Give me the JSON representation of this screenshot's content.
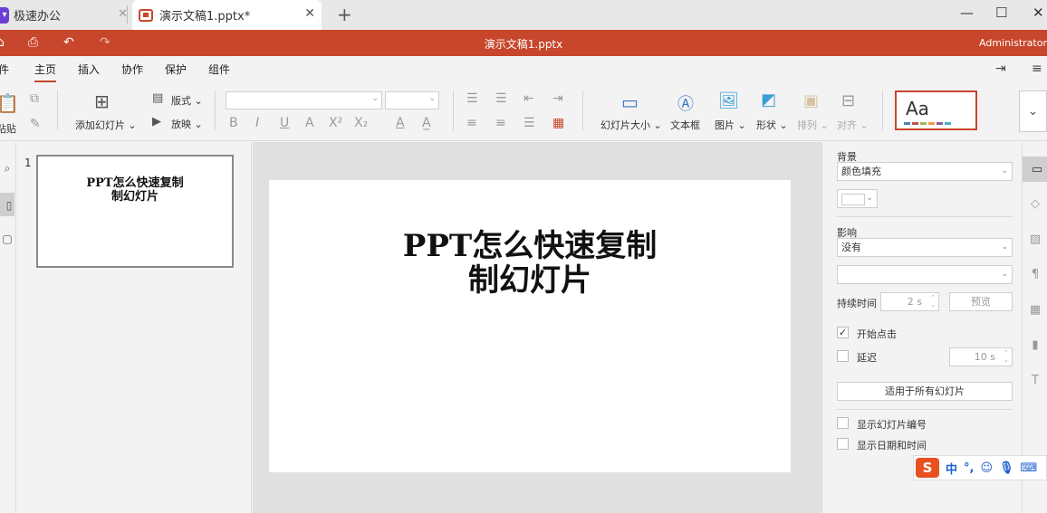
{
  "tabs": [
    {
      "label": "极速办公"
    },
    {
      "label": "演示文稿1.pptx*"
    }
  ],
  "title_bar": {
    "title": "演示文稿1.pptx",
    "user": "Administrator"
  },
  "menu": [
    "件",
    "主页",
    "插入",
    "协作",
    "保护",
    "组件"
  ],
  "ribbon": {
    "paste": "粘贴",
    "add_slide": "添加幻灯片",
    "layout": "版式",
    "play": "放映",
    "slide_size": "幻灯片大小",
    "text_box": "文本框",
    "image": "图片",
    "shape": "形状",
    "arrange": "排列",
    "align": "对齐",
    "theme_sample": "Aa",
    "theme_colors": [
      "#4f81bd",
      "#c0504d",
      "#9bbb59",
      "#f79646",
      "#8064a2",
      "#4bacc6"
    ]
  },
  "slides": [
    {
      "number": "1",
      "title": "PPT怎么快速复制\n制幻灯片"
    }
  ],
  "slide_panel": {
    "background_label": "背景",
    "background_value": "颜色填充",
    "effect_label": "影响",
    "effect_value": "没有",
    "duration_label": "持续时间",
    "duration_value": "2 s",
    "preview_button": "预览",
    "start_on_click": "开始点击",
    "start_on_click_checked": true,
    "delay_label": "延迟",
    "delay_checked": false,
    "delay_value": "10 s",
    "apply_all_button": "适用于所有幻灯片",
    "show_slide_number": "显示幻灯片编号",
    "show_date_time": "显示日期和时间"
  },
  "ime": {
    "logo": "S",
    "mode": "中"
  },
  "colors": {
    "accent": "#c8462b",
    "ime_logo": "#e8501f"
  }
}
